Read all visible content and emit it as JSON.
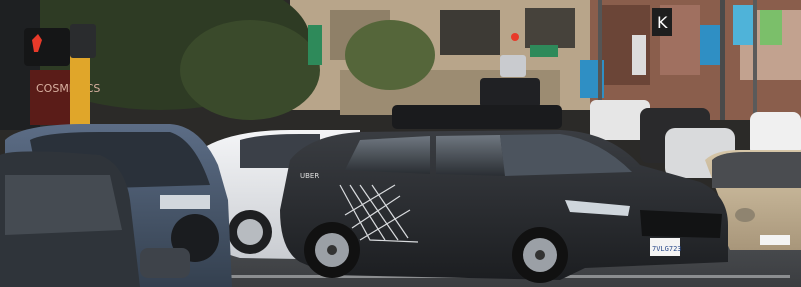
{
  "scene": {
    "subject": "Uber self-driving test car with roof sensor pod in city traffic",
    "car_brand_mark": "UBER",
    "license_plate": "7VLG723",
    "storefront_sign": "COSMETICS",
    "pedestrian_signal": "don't walk (red hand)",
    "colors": {
      "sky_haze": "#c9c3b4",
      "building_tan": "#b8a58a",
      "building_brick": "#8a5e4c",
      "street": "#4a4c4f",
      "uber_car": "#2d2f33",
      "white_car": "#e9ebee",
      "gold_car": "#c9b79a",
      "blue_sign": "#2f8fc4",
      "green_sign": "#2e8a5a"
    }
  }
}
